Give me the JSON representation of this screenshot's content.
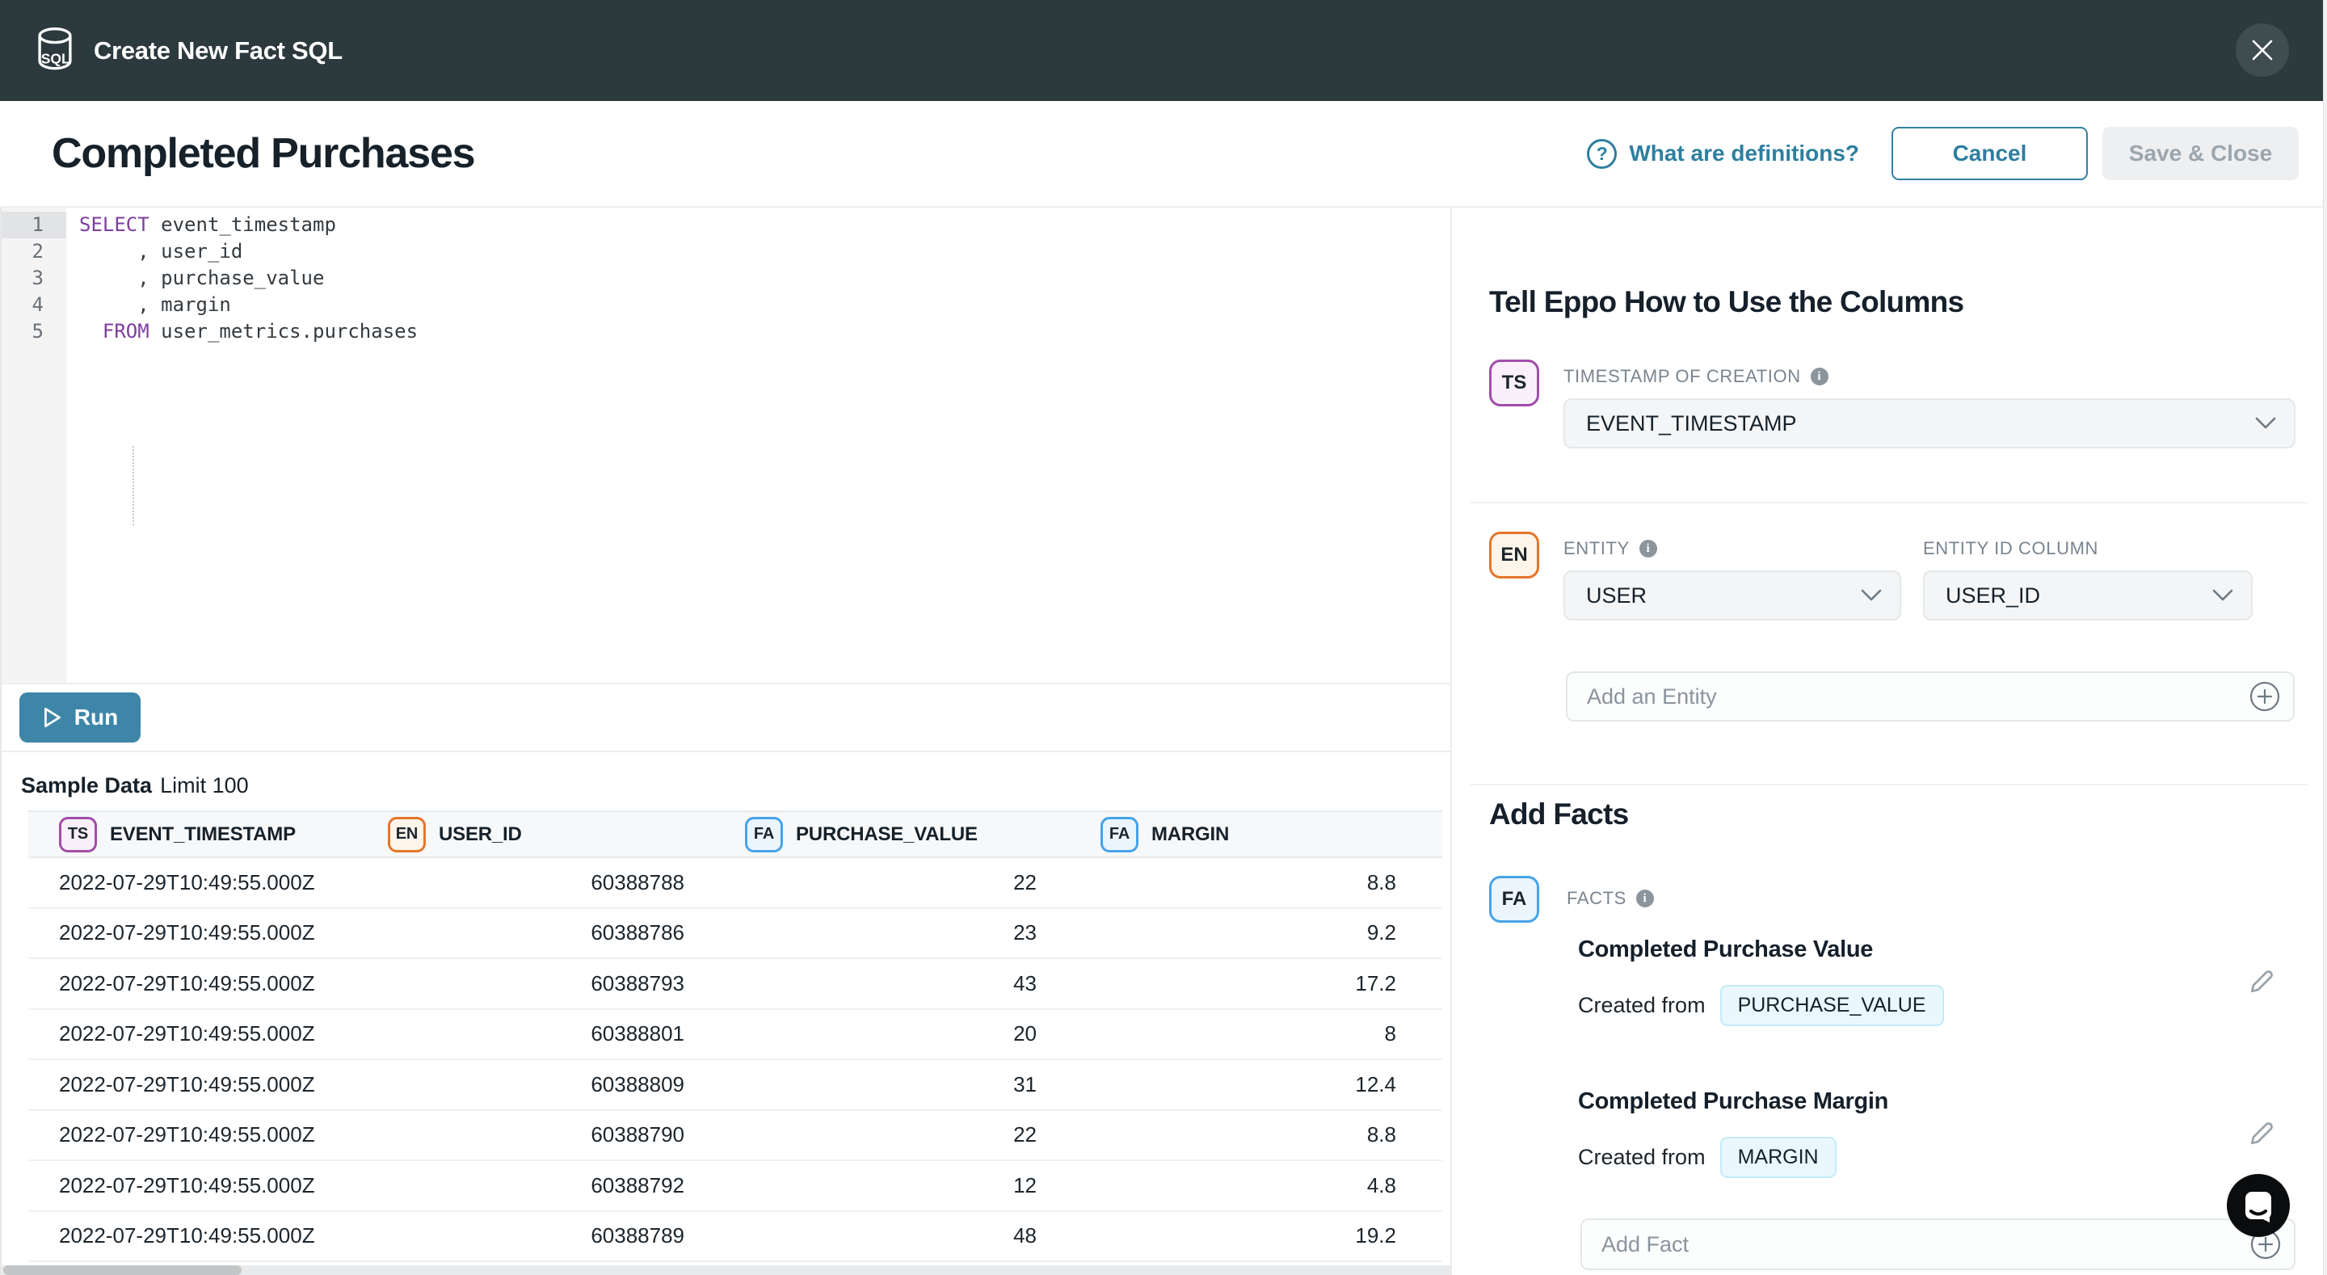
{
  "modal": {
    "title": "Create New Fact SQL"
  },
  "page": {
    "title": "Completed Purchases",
    "help": "What are definitions?",
    "cancel": "Cancel",
    "save": "Save & Close"
  },
  "editor": {
    "lines": [
      {
        "num": "1",
        "prefix": "",
        "kw": "SELECT",
        "rest": " event_timestamp"
      },
      {
        "num": "2",
        "prefix": "",
        "kw": "",
        "rest": "     , user_id"
      },
      {
        "num": "3",
        "prefix": "",
        "kw": "",
        "rest": "     , purchase_value"
      },
      {
        "num": "4",
        "prefix": "",
        "kw": "",
        "rest": "     , margin"
      },
      {
        "num": "5",
        "prefix": "  ",
        "kw": "FROM",
        "rest": " user_metrics.purchases"
      }
    ]
  },
  "run": {
    "label": "Run"
  },
  "sample": {
    "title": "Sample Data",
    "limit": "Limit 100"
  },
  "table": {
    "columns": [
      {
        "badge": "TS",
        "label": "EVENT_TIMESTAMP"
      },
      {
        "badge": "EN",
        "label": "USER_ID"
      },
      {
        "badge": "FA",
        "label": "PURCHASE_VALUE"
      },
      {
        "badge": "FA",
        "label": "MARGIN"
      }
    ],
    "rows": [
      [
        "2022-07-29T10:49:55.000Z",
        "60388788",
        "22",
        "8.8"
      ],
      [
        "2022-07-29T10:49:55.000Z",
        "60388786",
        "23",
        "9.2"
      ],
      [
        "2022-07-29T10:49:55.000Z",
        "60388793",
        "43",
        "17.2"
      ],
      [
        "2022-07-29T10:49:55.000Z",
        "60388801",
        "20",
        "8"
      ],
      [
        "2022-07-29T10:49:55.000Z",
        "60388809",
        "31",
        "12.4"
      ],
      [
        "2022-07-29T10:49:55.000Z",
        "60388790",
        "22",
        "8.8"
      ],
      [
        "2022-07-29T10:49:55.000Z",
        "60388792",
        "12",
        "4.8"
      ],
      [
        "2022-07-29T10:49:55.000Z",
        "60388789",
        "48",
        "19.2"
      ]
    ]
  },
  "panel": {
    "heading": "Tell Eppo How to Use the Columns",
    "timestamp": {
      "badge": "TS",
      "label": "TIMESTAMP OF CREATION",
      "value": "EVENT_TIMESTAMP"
    },
    "entity": {
      "badge": "EN",
      "label": "ENTITY",
      "value": "USER",
      "id_label": "ENTITY ID COLUMN",
      "id_value": "USER_ID",
      "add_placeholder": "Add an Entity"
    },
    "facts": {
      "heading": "Add Facts",
      "badge": "FA",
      "label": "FACTS",
      "items": [
        {
          "title": "Completed Purchase Value",
          "created_from": "Created from",
          "column": "PURCHASE_VALUE"
        },
        {
          "title": "Completed Purchase Margin",
          "created_from": "Created from",
          "column": "MARGIN"
        }
      ],
      "add_placeholder": "Add Fact"
    }
  },
  "colors": {
    "header_bg": "#2c393d",
    "accent_teal": "#3e86a8",
    "link_teal": "#2e7f9f",
    "sql_keyword": "#7d3e9e",
    "badge_timestamp": "#a14da8",
    "badge_entity": "#e4762a",
    "badge_fact": "#47a3e8"
  }
}
